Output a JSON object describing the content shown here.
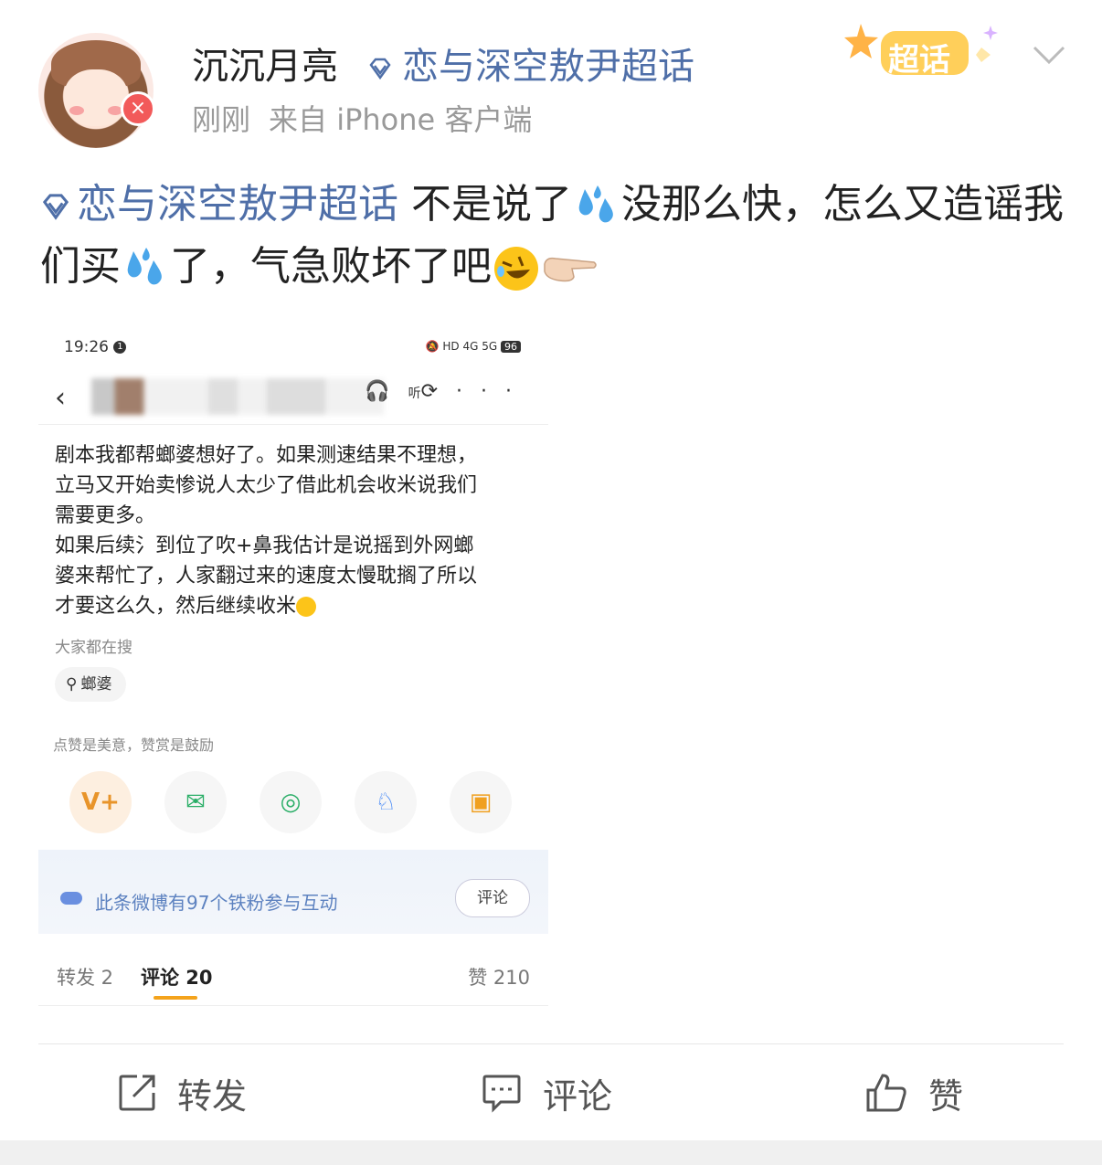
{
  "post": {
    "username": "沉沉月亮",
    "topic_tag": "恋与深空敖尹超话",
    "time": "刚刚",
    "source": "来自 iPhone 客户端",
    "super_topic_badge": "超话",
    "text_tag": "恋与深空敖尹超话",
    "text_part1": " 不是说了",
    "text_part2": "没那么快，怎么又造谣我们买",
    "text_part3": "了，气急败坏了吧"
  },
  "embedded": {
    "status_time": "19:26",
    "status_notif": "1",
    "status_signal_4g": "4G",
    "status_signal_5g": "5G",
    "status_hd": "HD",
    "battery": "96",
    "nav_listen": "听",
    "body_lines": [
      "剧本我都帮螂婆想好了。如果测速结果不理想，",
      "立马又开始卖惨说人太少了借此机会收米说我们",
      "需要更多。",
      "如果后续氵到位了吹+鼻我估计是说摇到外网螂",
      "婆来帮忙了，人家翻过来的速度太慢耽搁了所以",
      "才要这么久，然后继续收米"
    ],
    "search_hint": "大家都在搜",
    "search_chip": "螂婆",
    "praise_text": "点赞是美意，赞赏是鼓励",
    "fans_text": "此条微博有97个铁粉参与互动",
    "fans_button": "评论",
    "tab_repost": "转发 2",
    "tab_comment": "评论 20",
    "tab_like": "赞 210"
  },
  "actions": {
    "repost": "转发",
    "comment": "评论",
    "like": "赞"
  },
  "colors": {
    "topic_blue": "#4f6fa8",
    "accent_orange": "#f4a31c"
  }
}
